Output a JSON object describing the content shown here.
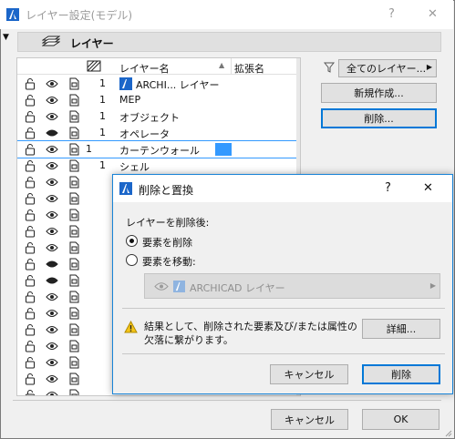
{
  "window": {
    "title": "レイヤー設定(モデル)",
    "help": "?",
    "close": "✕"
  },
  "panel": {
    "title": "レイヤー"
  },
  "table": {
    "col_name": "レイヤー名",
    "col_ext": "拡張名",
    "rows": [
      {
        "num": "1",
        "name": "ARCHI... レイヤー"
      },
      {
        "num": "1",
        "name": "MEP"
      },
      {
        "num": "1",
        "name": "オブジェクト"
      },
      {
        "num": "1",
        "name": "オペレータ"
      },
      {
        "num": "1",
        "name": "カーテンウォール"
      },
      {
        "num": "1",
        "name": "シェル"
      }
    ]
  },
  "right": {
    "filter_label": "全てのレイヤー...",
    "new_label": "新規作成...",
    "delete_label": "削除..."
  },
  "footer": {
    "cancel": "キャンセル",
    "ok": "OK"
  },
  "dialog": {
    "title": "削除と置換",
    "help": "?",
    "close": "✕",
    "prompt": "レイヤーを削除後:",
    "opt_delete": "要素を削除",
    "opt_move": "要素を移動:",
    "move_target": "ARCHICAD レイヤー",
    "warning_line1": "結果として、削除された要素及び/または属性の",
    "warning_line2": "欠落に繋がります。",
    "details_label": "詳細...",
    "cancel_label": "キャンセル",
    "delete_label": "削除"
  },
  "colors": {
    "accent": "#0078d7",
    "selection": "#3399ff"
  }
}
